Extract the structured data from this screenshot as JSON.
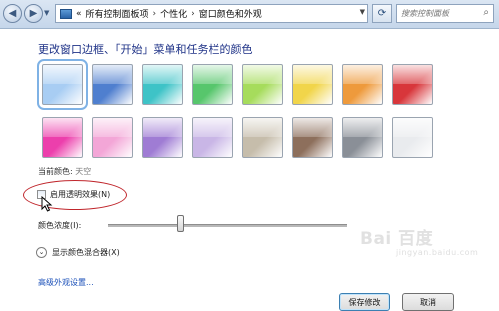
{
  "address_bar": {
    "back_icon": "back-arrow-icon",
    "forward_icon": "forward-arrow-icon",
    "breadcrumb": {
      "overflow": "«",
      "items": [
        "所有控制面板项",
        "个性化",
        "窗口颜色和外观"
      ]
    },
    "refresh_icon": "refresh-icon",
    "search_placeholder": "搜索控制面板"
  },
  "main": {
    "heading": "更改窗口边框、「开始」菜单和任务栏的颜色",
    "swatches": [
      {
        "name": "sky",
        "color": "#a8cdf3",
        "selected": true
      },
      {
        "name": "twilight",
        "color": "#4f7fcf",
        "selected": false
      },
      {
        "name": "sea",
        "color": "#3ec3c7",
        "selected": false
      },
      {
        "name": "leaf",
        "color": "#57c66c",
        "selected": false
      },
      {
        "name": "lime",
        "color": "#a6dc5c",
        "selected": false
      },
      {
        "name": "pumpkin",
        "color": "#f1d54a",
        "selected": false
      },
      {
        "name": "sunset",
        "color": "#ee9a3c",
        "selected": false
      },
      {
        "name": "ruby",
        "color": "#d8363b",
        "selected": false
      },
      {
        "name": "fuchsia",
        "color": "#ec3fac",
        "selected": false
      },
      {
        "name": "blush",
        "color": "#f3a6d7",
        "selected": false
      },
      {
        "name": "violet",
        "color": "#9f7cd4",
        "selected": false
      },
      {
        "name": "lavender",
        "color": "#c9b6e6",
        "selected": false
      },
      {
        "name": "taupe",
        "color": "#c6bdab",
        "selected": false
      },
      {
        "name": "chocolate",
        "color": "#8d6f5c",
        "selected": false
      },
      {
        "name": "slate",
        "color": "#8a8f97",
        "selected": false
      },
      {
        "name": "frost",
        "color": "#e9ebee",
        "selected": false
      }
    ],
    "current_color_label": "当前颜色:",
    "current_color_value": "天空",
    "transparency_label": "启用透明效果(N)",
    "transparency_checked": false,
    "intensity_label": "颜色浓度(I):",
    "intensity_value": 0.3,
    "mixer_label": "显示颜色混合器(X)",
    "advanced_link": "高级外观设置..."
  },
  "footer": {
    "save_label": "保存修改",
    "cancel_label": "取消"
  },
  "watermark": {
    "text": "Bai  百度",
    "sub": "jingyan.baidu.com"
  }
}
